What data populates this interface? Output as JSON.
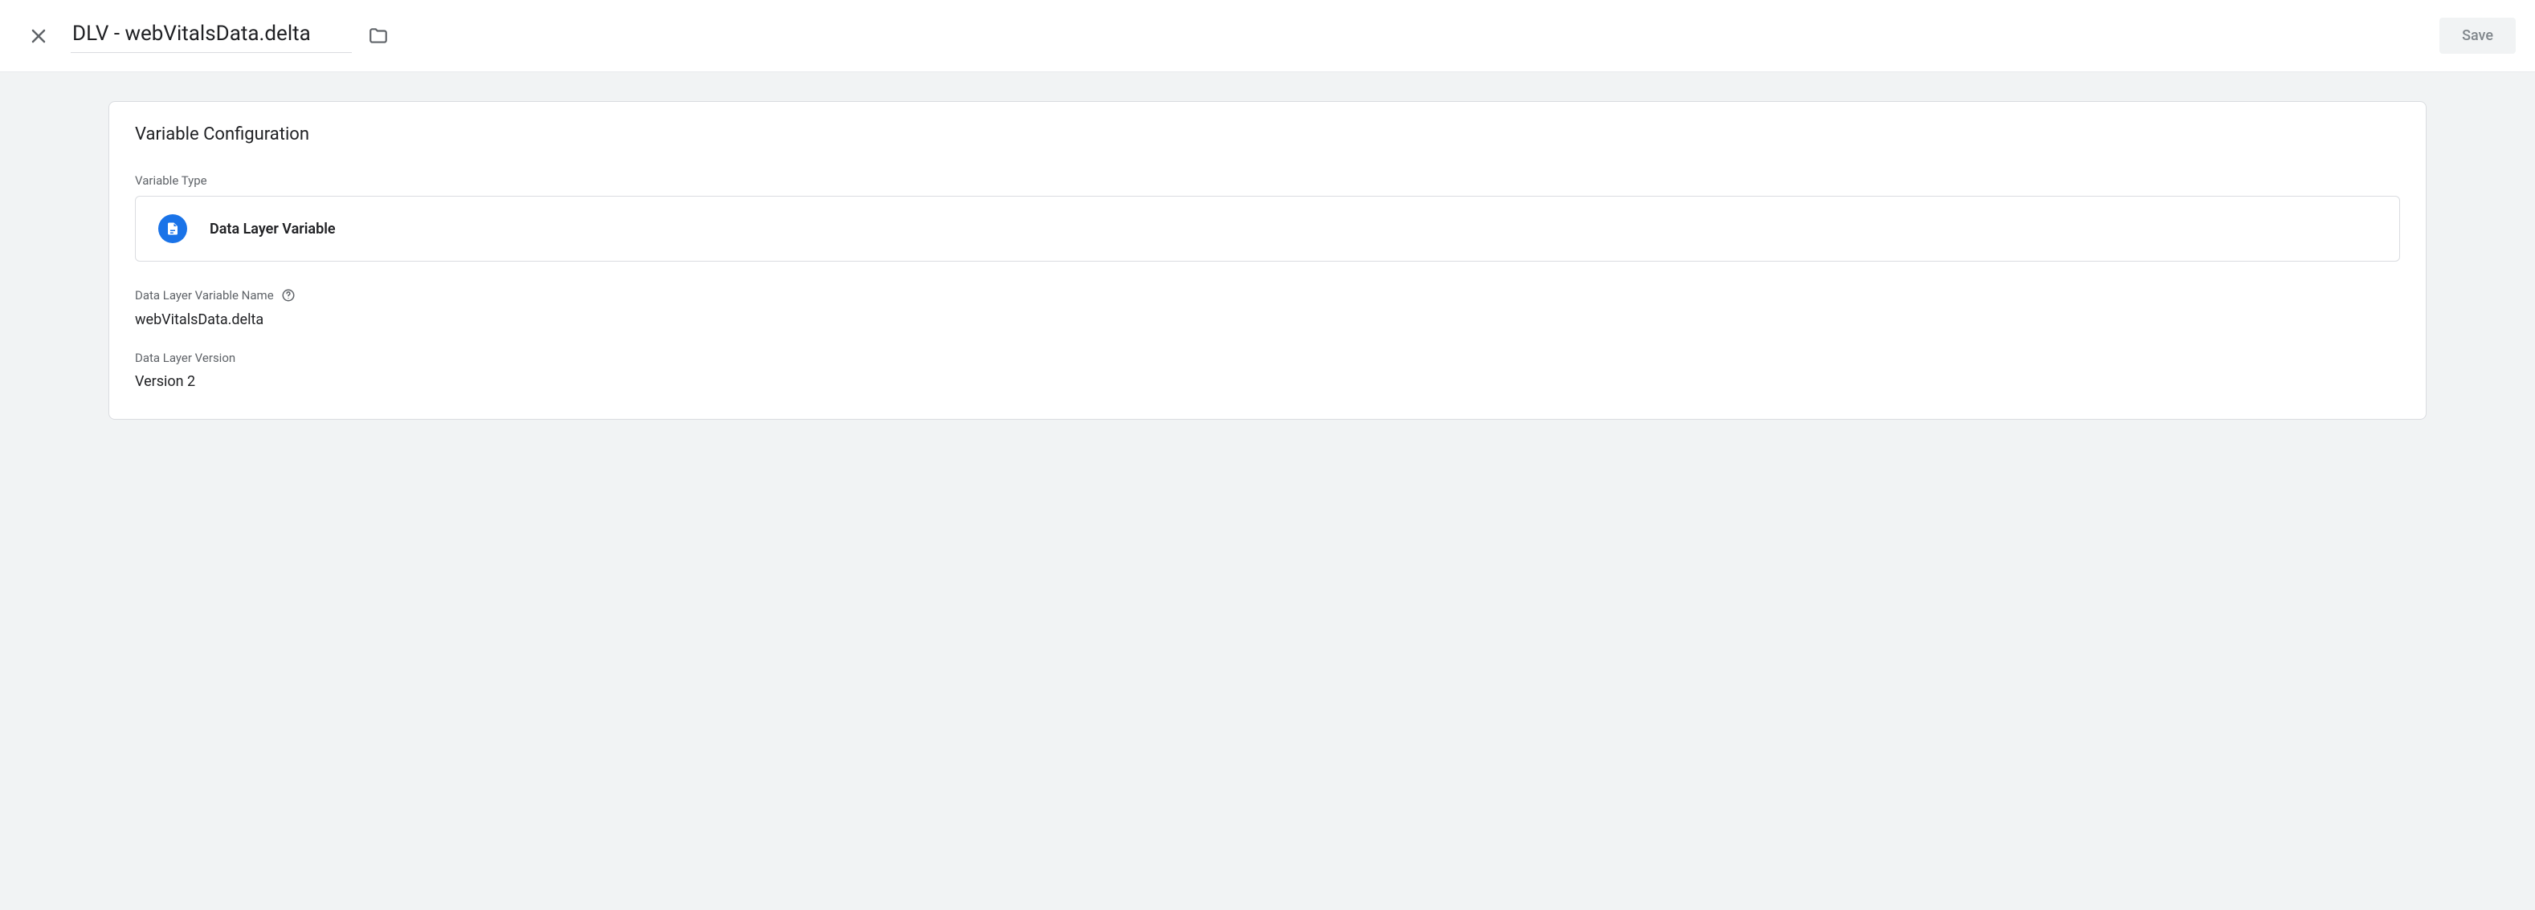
{
  "header": {
    "title": "DLV - webVitalsData.delta",
    "save_label": "Save"
  },
  "card": {
    "title": "Variable Configuration",
    "variable_type_label": "Variable Type",
    "variable_type_name": "Data Layer Variable",
    "variable_name_label": "Data Layer Variable Name",
    "variable_name_value": "webVitalsData.delta",
    "version_label": "Data Layer Version",
    "version_value": "Version 2"
  }
}
